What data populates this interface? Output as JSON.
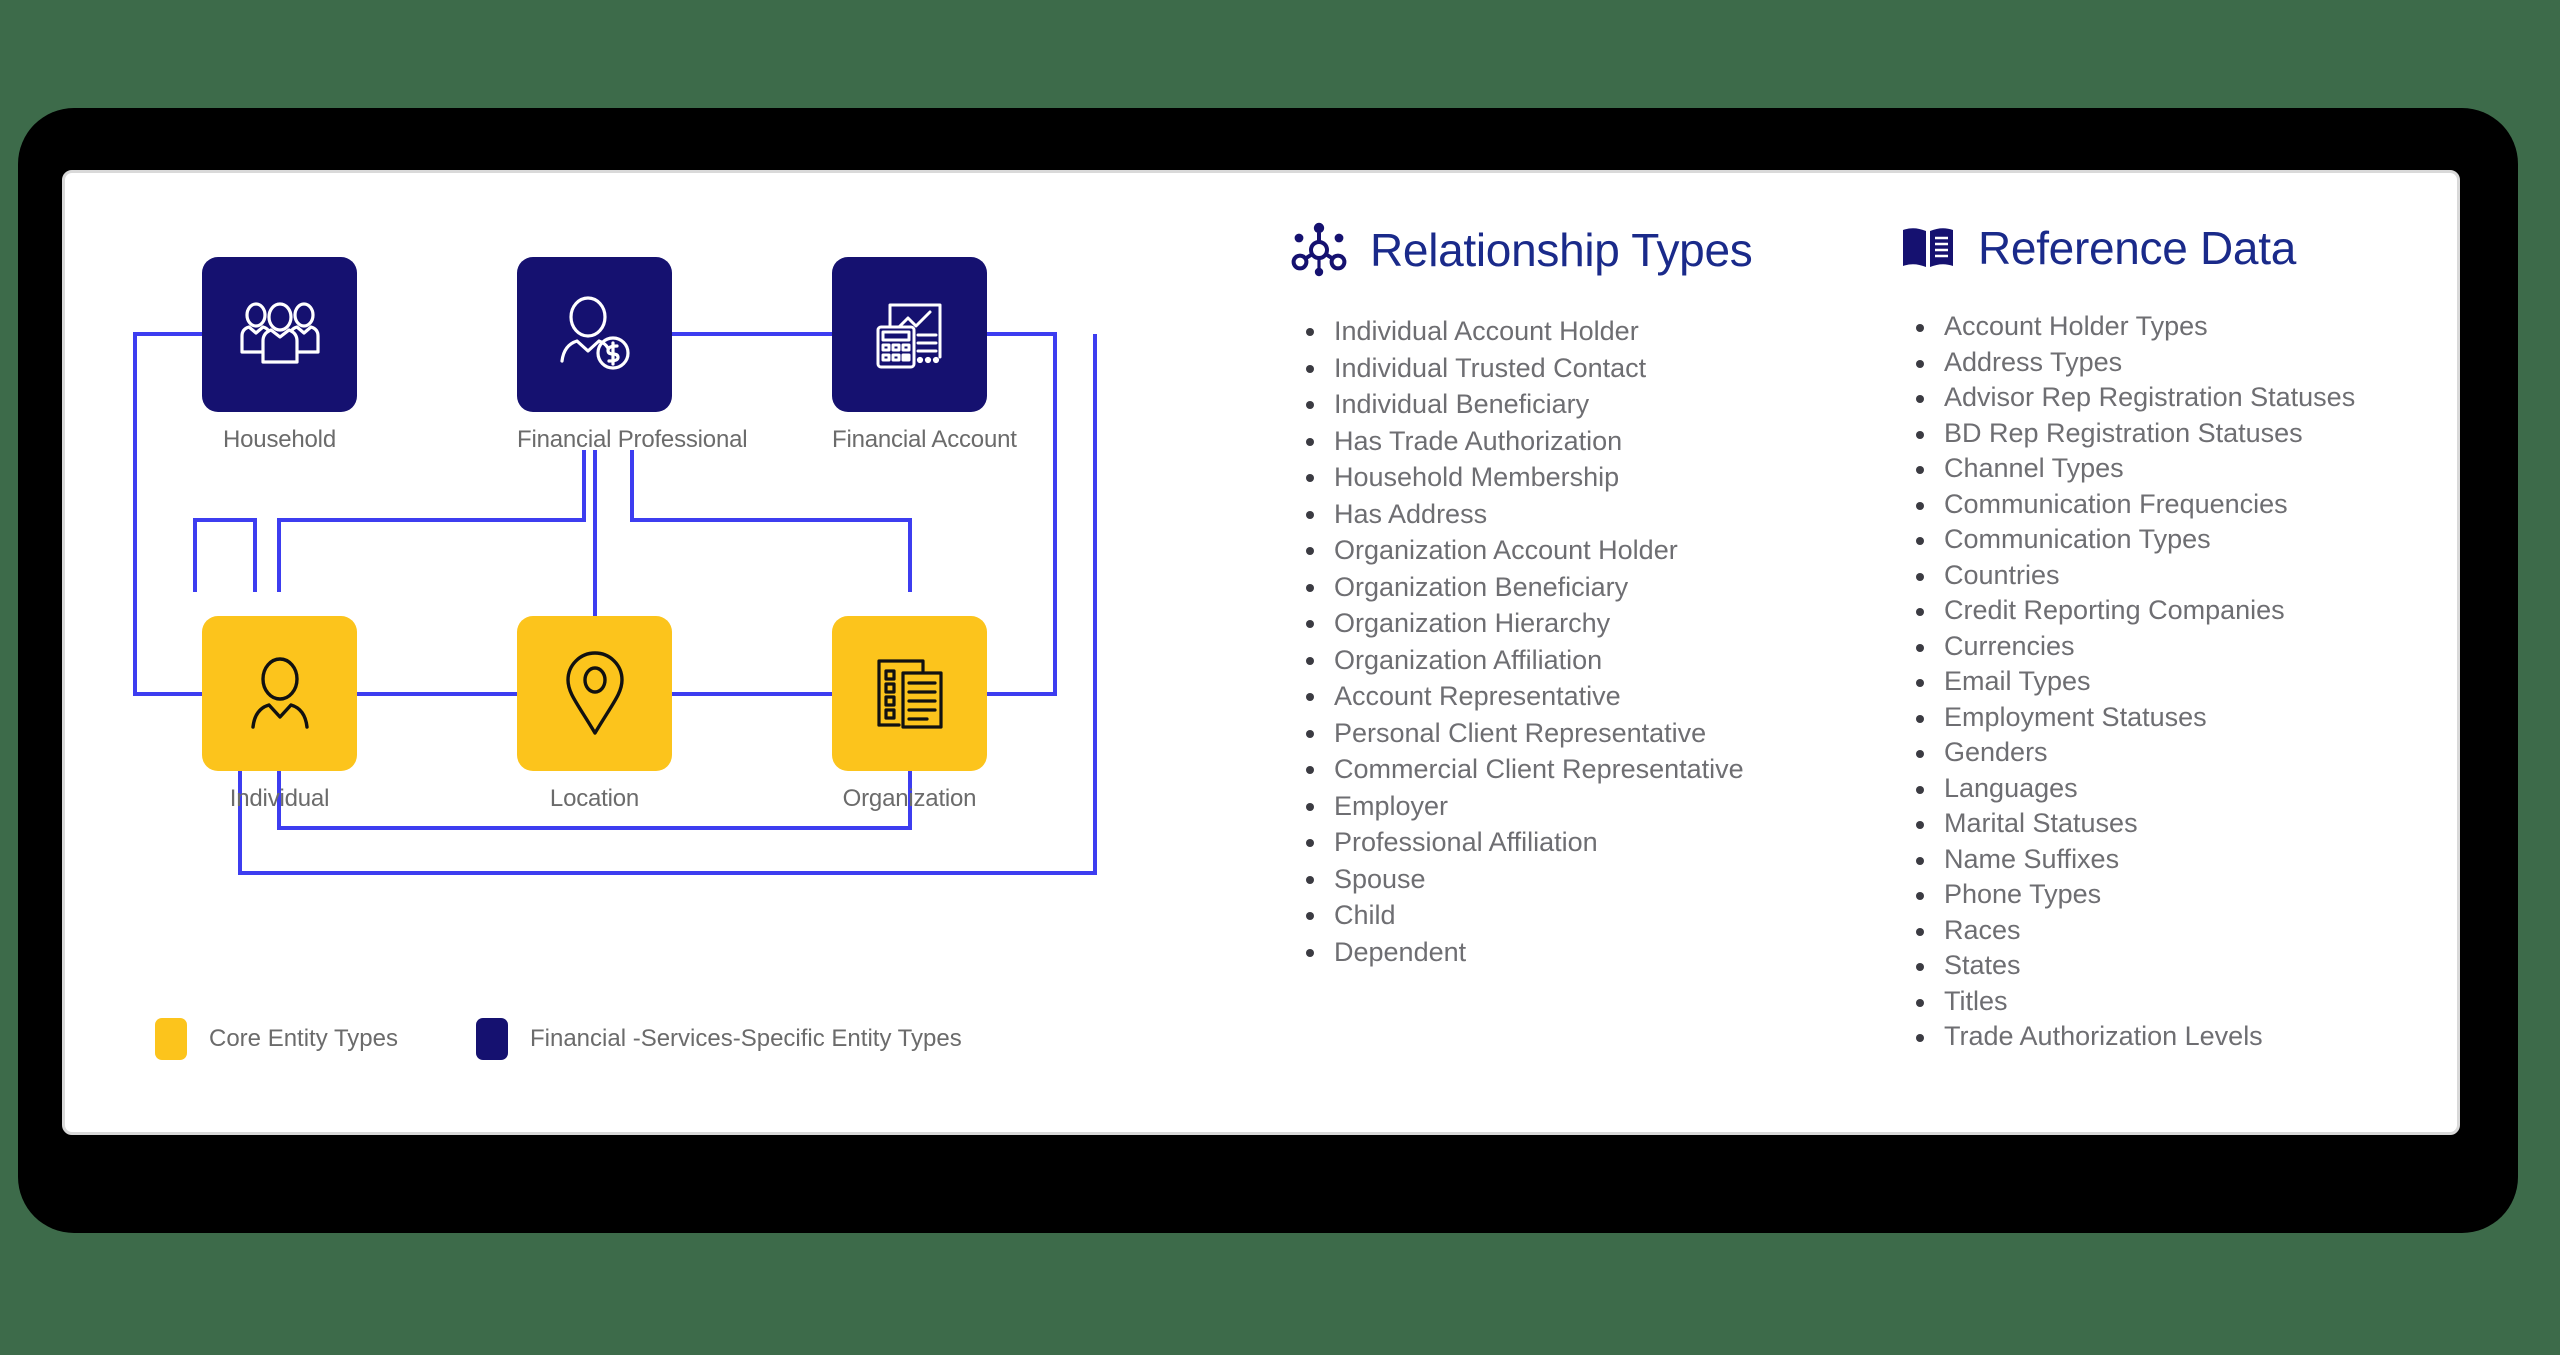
{
  "diagram": {
    "nodes": [
      {
        "id": "household",
        "label": "Household",
        "kind": "financial",
        "icon": "people-group-icon"
      },
      {
        "id": "financial-pro",
        "label": "Financial Professional",
        "kind": "financial",
        "icon": "person-dollar-icon"
      },
      {
        "id": "financial-account",
        "label": "Financial Account",
        "kind": "financial",
        "icon": "calculator-chart-icon"
      },
      {
        "id": "individual",
        "label": "Individual",
        "kind": "core",
        "icon": "person-icon"
      },
      {
        "id": "location",
        "label": "Location",
        "kind": "core",
        "icon": "map-pin-icon"
      },
      {
        "id": "organization",
        "label": "Organization",
        "kind": "core",
        "icon": "building-document-icon"
      }
    ],
    "legend": [
      {
        "label": "Core Entity Types",
        "color": "#fcc41c"
      },
      {
        "label": "Financial -Services-Specific Entity Types",
        "color": "#151170"
      }
    ],
    "colors": {
      "core": "#fcc41c",
      "financial": "#151170",
      "connector": "#3d3df0",
      "caption": "#6b6b6b"
    }
  },
  "relationship_types": {
    "title": "Relationship Types",
    "icon": "network-nodes-icon",
    "items": [
      "Individual Account Holder",
      "Individual Trusted Contact",
      "Individual Beneficiary",
      "Has Trade Authorization",
      "Household Membership",
      "Has Address",
      "Organization Account Holder",
      "Organization Beneficiary",
      "Organization Hierarchy",
      "Organization Affiliation",
      "Account Representative",
      "Personal Client Representative",
      "Commercial Client Representative",
      "Employer",
      "Professional Affiliation",
      "Spouse",
      "Child",
      "Dependent"
    ]
  },
  "reference_data": {
    "title": "Reference Data",
    "icon": "open-book-icon",
    "items": [
      "Account Holder Types",
      "Address Types",
      "Advisor Rep Registration Statuses",
      "BD Rep Registration Statuses",
      "Channel Types",
      "Communication Frequencies",
      "Communication Types",
      "Countries",
      "Credit Reporting Companies",
      "Currencies",
      "Email Types",
      "Employment Statuses",
      "Genders",
      "Languages",
      "Marital Statuses",
      "Name Suffixes",
      "Phone Types",
      "Races",
      "States",
      "Titles",
      "Trade Authorization Levels"
    ]
  }
}
